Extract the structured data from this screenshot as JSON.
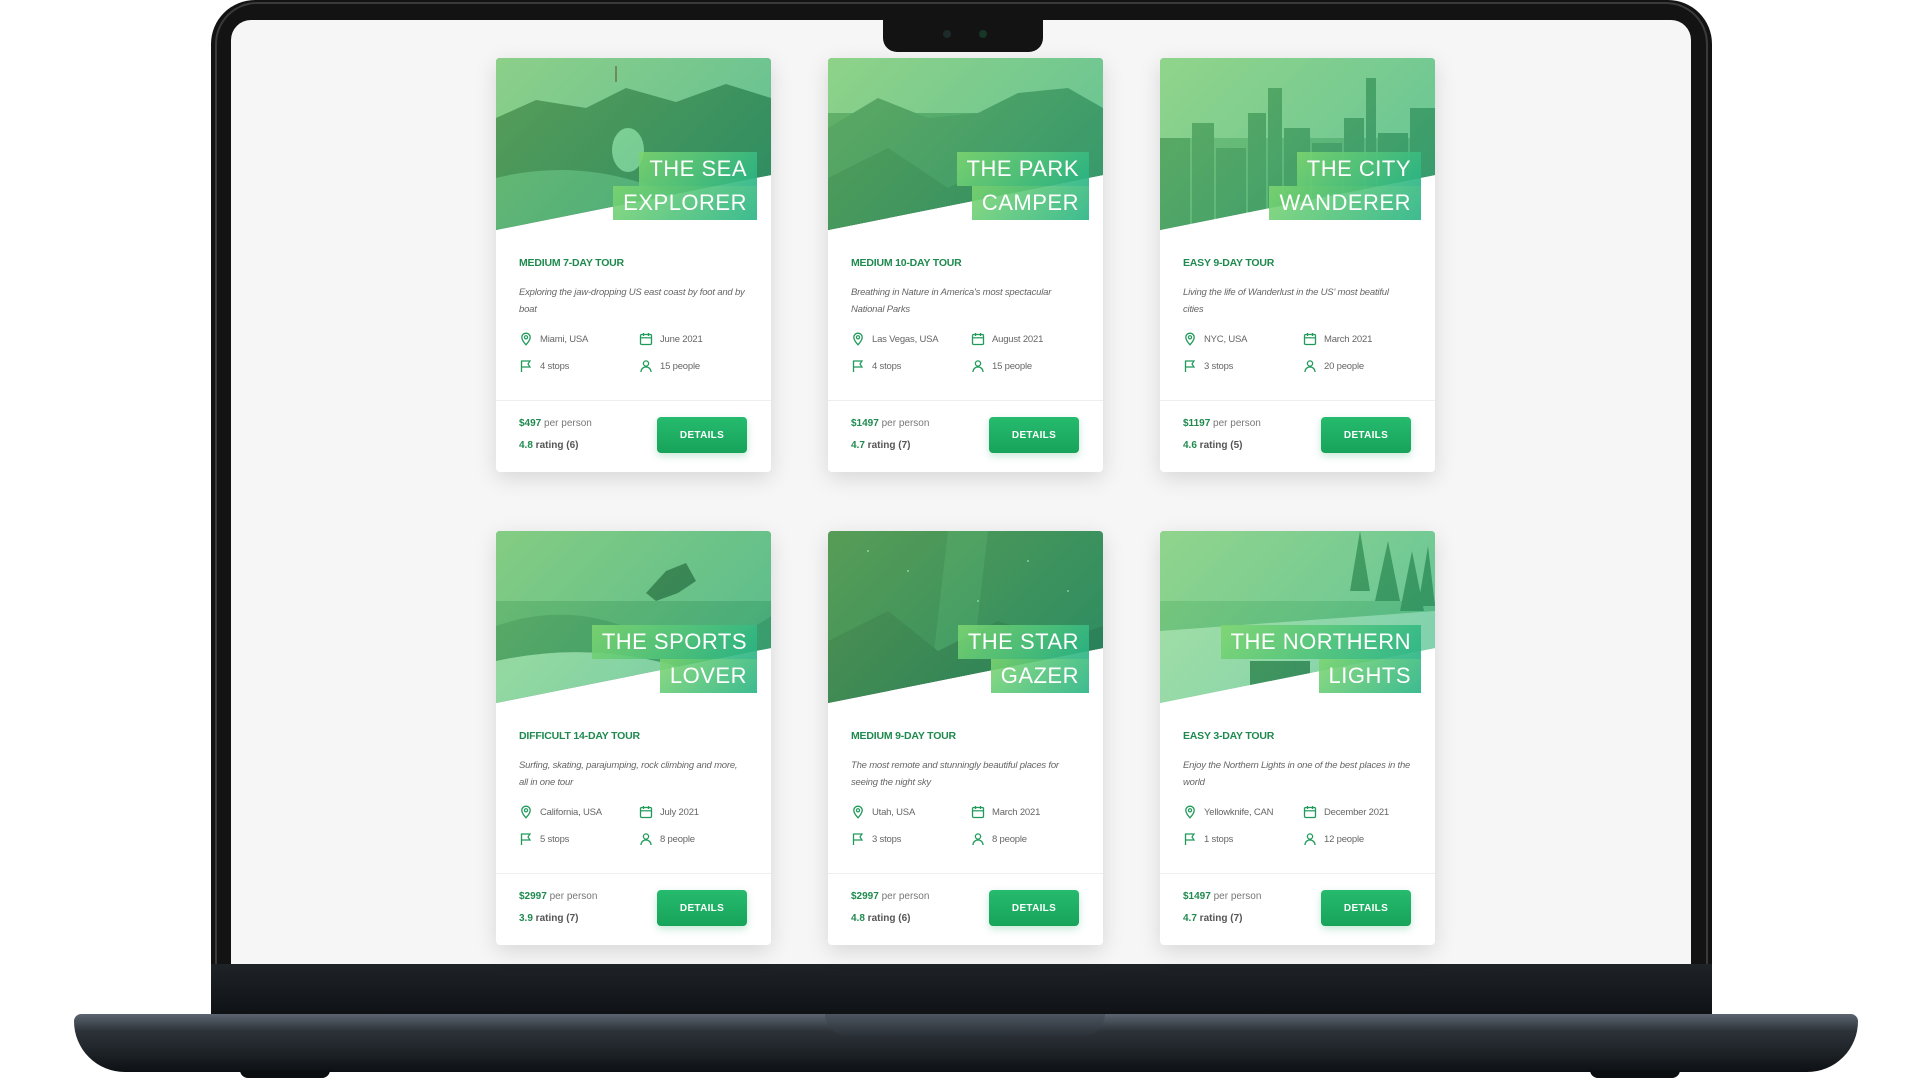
{
  "colors": {
    "accent": "#1f8a4f",
    "button": "#17a35a",
    "screen_bg": "#f6f6f6",
    "frame": "#131313"
  },
  "cards": [
    {
      "title_line1": "THE SEA",
      "title_line2": "EXPLORER",
      "subtitle": "MEDIUM 7-DAY TOUR",
      "description": "Exploring the jaw-dropping US east coast by foot and by boat",
      "location": "Miami, USA",
      "date": "June 2021",
      "stops": "4 stops",
      "people": "15 people",
      "price": "$497",
      "price_suffix": "per person",
      "rating": "4.8",
      "rating_suffix": "rating (6)",
      "button": "DETAILS",
      "image_theme": "sea-cliffs"
    },
    {
      "title_line1": "THE PARK",
      "title_line2": "CAMPER",
      "subtitle": "MEDIUM 10-DAY TOUR",
      "description": "Breathing in Nature in America's most spectacular National Parks",
      "location": "Las Vegas, USA",
      "date": "August 2021",
      "stops": "4 stops",
      "people": "15 people",
      "price": "$1497",
      "price_suffix": "per person",
      "rating": "4.7",
      "rating_suffix": "rating (7)",
      "button": "DETAILS",
      "image_theme": "canyon"
    },
    {
      "title_line1": "THE CITY",
      "title_line2": "WANDERER",
      "subtitle": "EASY 9-DAY TOUR",
      "description": "Living the life of Wanderlust in the US' most beatiful cities",
      "location": "NYC, USA",
      "date": "March 2021",
      "stops": "3 stops",
      "people": "20 people",
      "price": "$1197",
      "price_suffix": "per person",
      "rating": "4.6",
      "rating_suffix": "rating (5)",
      "button": "DETAILS",
      "image_theme": "city-skyline"
    },
    {
      "title_line1": "THE SPORTS",
      "title_line2": "LOVER",
      "subtitle": "DIFFICULT 14-DAY TOUR",
      "description": "Surfing, skating, parajumping, rock climbing and more, all in one tour",
      "location": "California, USA",
      "date": "July 2021",
      "stops": "5 stops",
      "people": "8 people",
      "price": "$2997",
      "price_suffix": "per person",
      "rating": "3.9",
      "rating_suffix": "rating (7)",
      "button": "DETAILS",
      "image_theme": "surfer"
    },
    {
      "title_line1": "THE STAR",
      "title_line2": "GAZER",
      "subtitle": "MEDIUM 9-DAY TOUR",
      "description": "The most remote and stunningly beautiful places for seeing the night sky",
      "location": "Utah, USA",
      "date": "March 2021",
      "stops": "3 stops",
      "people": "8 people",
      "price": "$2997",
      "price_suffix": "per person",
      "rating": "4.8",
      "rating_suffix": "rating (6)",
      "button": "DETAILS",
      "image_theme": "night-sky"
    },
    {
      "title_line1": "THE NORTHERN",
      "title_line2": "LIGHTS",
      "subtitle": "EASY 3-DAY TOUR",
      "description": "Enjoy the Northern Lights in one of the best places in the world",
      "location": "Yellowknife, CAN",
      "date": "December 2021",
      "stops": "1 stops",
      "people": "12 people",
      "price": "$1497",
      "price_suffix": "per person",
      "rating": "4.7",
      "rating_suffix": "rating (7)",
      "button": "DETAILS",
      "image_theme": "snowy-forest"
    }
  ]
}
